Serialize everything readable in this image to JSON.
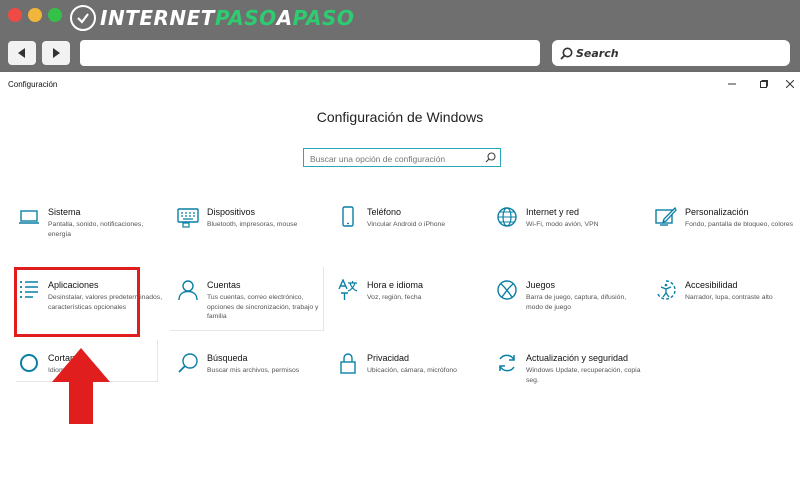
{
  "browser": {
    "logo_part1": "INTERNET",
    "logo_part2": "PASO",
    "logo_part3": "A",
    "logo_part4": "PASO",
    "search_label": "Search"
  },
  "window": {
    "title": "Configuración",
    "heading": "Configuración de Windows",
    "search_placeholder": "Buscar una opción de configuración"
  },
  "tiles": [
    {
      "title": "Sistema",
      "desc": "Pantalla, sonido, notificaciones, energía",
      "icon": "laptop-icon"
    },
    {
      "title": "Dispositivos",
      "desc": "Bluetooth, impresoras, mouse",
      "icon": "keyboard-icon"
    },
    {
      "title": "Teléfono",
      "desc": "Vincular Android o iPhone",
      "icon": "phone-icon"
    },
    {
      "title": "Internet y red",
      "desc": "Wi-Fi, modo avión, VPN",
      "icon": "globe-icon"
    },
    {
      "title": "Personalización",
      "desc": "Fondo, pantalla de bloqueo, colores",
      "icon": "paint-icon"
    },
    {
      "title": "Aplicaciones",
      "desc": "Desinstalar, valores predeterminados, características opcionales",
      "icon": "apps-list-icon"
    },
    {
      "title": "Cuentas",
      "desc": "Tus cuentas, correo electrónico, opciones de sincronización, trabajo y familia",
      "icon": "person-icon"
    },
    {
      "title": "Hora e idioma",
      "desc": "Voz, región, fecha",
      "icon": "time-language-icon"
    },
    {
      "title": "Juegos",
      "desc": "Barra de juego, captura, difusión, modo de juego",
      "icon": "xbox-icon"
    },
    {
      "title": "Accesibilidad",
      "desc": "Narrador, lupa, contraste alto",
      "icon": "accessibility-icon"
    },
    {
      "title": "Cortana",
      "desc": "Idioma, permisos",
      "icon": "cortana-icon"
    },
    {
      "title": "Búsqueda",
      "desc": "Buscar mis archivos, permisos",
      "icon": "search-icon"
    },
    {
      "title": "Privacidad",
      "desc": "Ubicación, cámara, micrófono",
      "icon": "lock-icon"
    },
    {
      "title": "Actualización y seguridad",
      "desc": "Windows Update, recuperación, copia seg.",
      "icon": "update-icon"
    }
  ],
  "colors": {
    "accent": "#0a7fa5",
    "highlight": "#e01e1e"
  }
}
